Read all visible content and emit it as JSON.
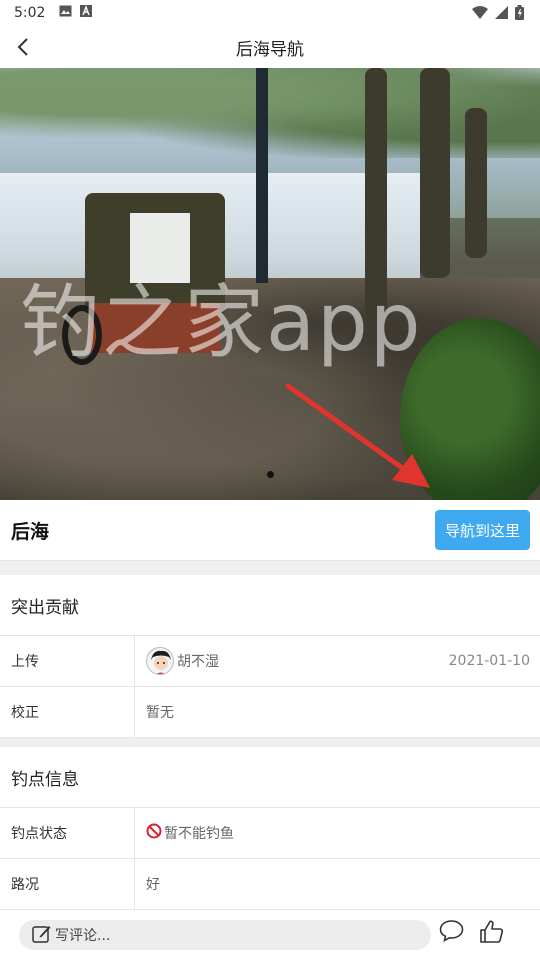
{
  "status_bar": {
    "time": "5:02"
  },
  "header": {
    "title": "后海导航"
  },
  "hero": {
    "watermark": "钓之家app",
    "page_indicator": 1
  },
  "place": {
    "name": "后海",
    "nav_button": "导航到这里"
  },
  "contribution": {
    "title": "突出贡献",
    "rows": [
      {
        "label": "上传",
        "user": "胡不湿",
        "date": "2021-01-10"
      },
      {
        "label": "校正",
        "value": "暂无"
      }
    ]
  },
  "spot_info": {
    "title": "钓点信息",
    "rows": [
      {
        "label": "钓点状态",
        "value": "暂不能钓鱼"
      },
      {
        "label": "路况",
        "value": "好"
      }
    ]
  },
  "footer": {
    "comment_placeholder": "写评论..."
  },
  "colors": {
    "accent": "#3fa9f0",
    "warning": "#d9232d"
  }
}
